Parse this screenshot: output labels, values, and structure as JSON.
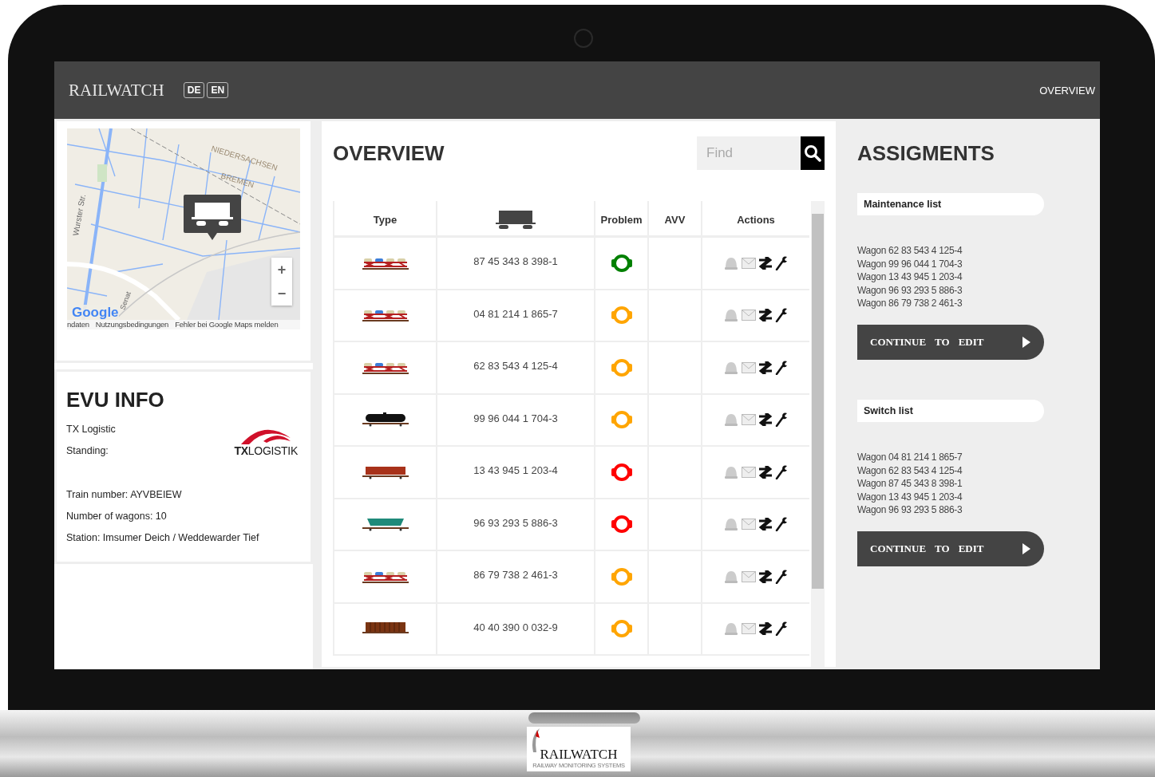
{
  "header": {
    "brand": "RAILWATCH",
    "languages": [
      "DE",
      "EN"
    ],
    "nav": "OVERVIEW"
  },
  "map": {
    "labels": [
      {
        "kind": "region",
        "text": "NIEDERSACHSEN"
      },
      {
        "kind": "region2",
        "text": "BREMEN"
      },
      {
        "kind": "street",
        "text": "Wurster Str."
      },
      {
        "kind": "street2",
        "text": "Senat"
      }
    ],
    "google": "Google",
    "attribution": [
      "ndaten",
      "Nutzungsbedingungen",
      "Fehler bei Google Maps melden"
    ],
    "zoom_in": "+",
    "zoom_out": "−"
  },
  "evu": {
    "title": "EVU INFO",
    "company": "TX Logistic",
    "standing": "Standing:",
    "logo": "**TX**LOGISTIK",
    "details": [
      "Train number: AYVBEIEW",
      "Number of wagons: 10",
      "Station: Imsumer Deich / Weddewarder Tief"
    ]
  },
  "overview": {
    "title": "OVERVIEW",
    "search": {
      "placeholder": "Find"
    },
    "columns": [
      "Type",
      "Problem",
      "AVV",
      "Actions"
    ],
    "rows": [
      {
        "kind": "car-carrier",
        "number": "87 45 343 8 398-1",
        "color": "#008000"
      },
      {
        "kind": "car-carrier",
        "number": "04 81 214 1 865-7",
        "color": "#ffa500"
      },
      {
        "kind": "car-carrier",
        "number": "62 83 543 4 125-4",
        "color": "#ffa500"
      },
      {
        "kind": "tank",
        "number": "99 96 044 1 704-3",
        "color": "#ffa500"
      },
      {
        "kind": "boxcar",
        "number": "13 43 945 1 203-4",
        "color": "#ff0000"
      },
      {
        "kind": "hopper",
        "number": "96 93 293 5 886-3",
        "color": "#ff0000"
      },
      {
        "kind": "car-carrier",
        "number": "86 79 738 2 461-3",
        "color": "#ffa500"
      },
      {
        "kind": "slatted",
        "number": "40 40 390 0 032-9",
        "color": "#ffa500"
      }
    ]
  },
  "assignments": {
    "title": "ASSIGMENTS",
    "lists": [
      {
        "name": "Maintenance list",
        "wagons": [
          "Wagon 62 83 543 4 125-4",
          "Wagon 99 96 044 1 704-3",
          "Wagon 13 43 945 1 203-4",
          "Wagon 96 93 293 5 886-3",
          "Wagon 86 79 738 2 461-3"
        ],
        "button": [
          "CONTINUE",
          "TO",
          "EDIT"
        ]
      },
      {
        "name": "Switch list",
        "wagons": [
          "Wagon 04 81 214 1 865-7",
          "Wagon 62 83 543 4 125-4",
          "Wagon 87 45 343 8 398-1",
          "Wagon 13 43 945 1 203-4",
          "Wagon 96 93 293 5 886-3"
        ],
        "button": [
          "CONTINUE",
          "TO",
          "EDIT"
        ]
      }
    ]
  },
  "base_logo": {
    "name": "RAILWATCH",
    "tagline": "RAILWAY MONITORING SYSTEMS"
  }
}
